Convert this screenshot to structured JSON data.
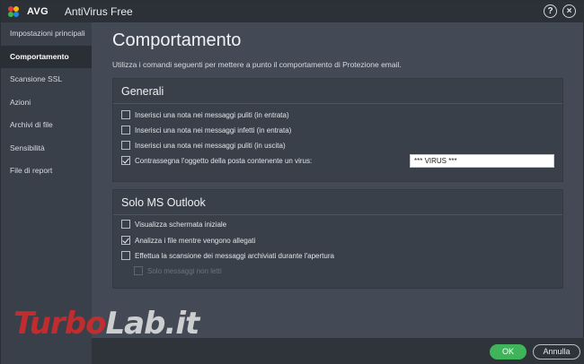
{
  "titlebar": {
    "logo_text": "AVG",
    "app_title": "AntiVirus Free",
    "help_label": "?",
    "close_label": "×"
  },
  "sidebar": {
    "items": [
      {
        "label": "Impostazioni principali",
        "active": false
      },
      {
        "label": "Comportamento",
        "active": true
      },
      {
        "label": "Scansione SSL",
        "active": false
      },
      {
        "label": "Azioni",
        "active": false
      },
      {
        "label": "Archivi di file",
        "active": false
      },
      {
        "label": "Sensibilità",
        "active": false
      },
      {
        "label": "File di report",
        "active": false
      }
    ]
  },
  "main": {
    "title": "Comportamento",
    "description": "Utilizza i comandi seguenti per mettere a punto il comportamento di Protezione email."
  },
  "generali": {
    "title": "Generali",
    "options": [
      {
        "label": "Inserisci una nota nei messaggi puliti (in entrata)",
        "checked": false
      },
      {
        "label": "Inserisci una nota nei messaggi infetti (in entrata)",
        "checked": false
      },
      {
        "label": "Inserisci una nota nei messaggi puliti (in uscita)",
        "checked": false
      },
      {
        "label": "Contrassegna l'oggetto della posta contenente un virus:",
        "checked": true
      }
    ],
    "subject_tag_value": "*** VIRUS ***"
  },
  "outlook": {
    "title": "Solo MS Outlook",
    "options": [
      {
        "label": "Visualizza schermata iniziale",
        "checked": false
      },
      {
        "label": "Analizza i file mentre vengono allegati",
        "checked": true
      },
      {
        "label": "Effettua la scansione dei messaggi archiviati durante l'apertura",
        "checked": false
      },
      {
        "label": "Solo messaggi non letti",
        "checked": false,
        "disabled": true
      }
    ]
  },
  "footer": {
    "ok_label": "OK",
    "cancel_label": "Annulla"
  },
  "watermark": {
    "part1": "Turbo",
    "part2": "Lab.it"
  },
  "colors": {
    "accent_green": "#3fb45a",
    "background": "#434a55",
    "sidebar_bg": "#3a4049",
    "watermark_red": "#d92a2a"
  }
}
